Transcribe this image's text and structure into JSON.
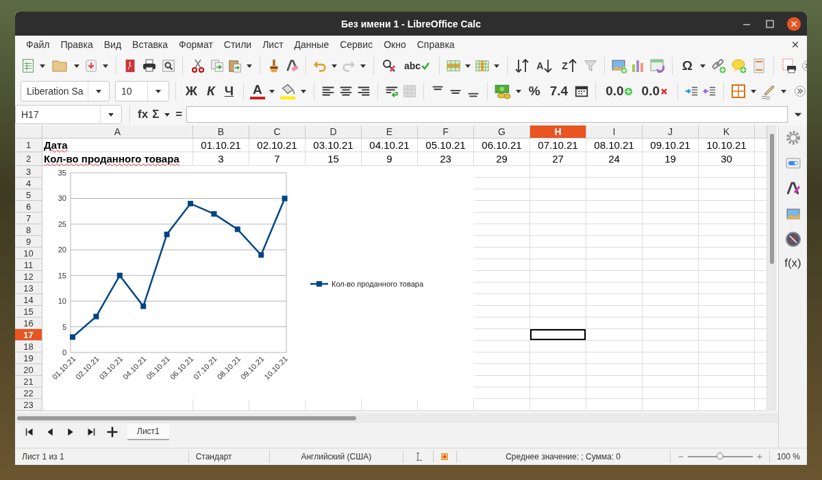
{
  "window": {
    "title": "Без имени 1 - LibreOffice Calc"
  },
  "menu": [
    "Файл",
    "Правка",
    "Вид",
    "Вставка",
    "Формат",
    "Стили",
    "Лист",
    "Данные",
    "Сервис",
    "Окно",
    "Справка"
  ],
  "standard_toolbar": {
    "spelling": "abc",
    "sort_ascending": "A",
    "sort_descending": "Z",
    "special_character": "Ω"
  },
  "formatting_toolbar": {
    "font_name": "Liberation Sa",
    "font_size": "10",
    "bold": "Ж",
    "italic": "К",
    "underline": "Ч",
    "font_color": "A",
    "percent": "%",
    "number": "7.4",
    "add_decimal_place": "0.0",
    "delete_decimal_place": "0.0"
  },
  "formula_bar": {
    "name_box": "H17",
    "function_wizard": "fx",
    "sum": "Σ",
    "formula": "="
  },
  "sheet": {
    "columns": [
      {
        "label": "A",
        "selected": false
      },
      {
        "label": "B",
        "selected": false
      },
      {
        "label": "C",
        "selected": false
      },
      {
        "label": "D",
        "selected": false
      },
      {
        "label": "E",
        "selected": false
      },
      {
        "label": "F",
        "selected": false
      },
      {
        "label": "G",
        "selected": false
      },
      {
        "label": "H",
        "selected": true
      },
      {
        "label": "I",
        "selected": false
      },
      {
        "label": "J",
        "selected": false
      },
      {
        "label": "K",
        "selected": false
      }
    ],
    "rows": [
      {
        "label": "1",
        "selected": false,
        "title": {
          "text": "Дата",
          "spell_error": true
        },
        "values": [
          "01.10.21",
          "02.10.21",
          "03.10.21",
          "04.10.21",
          "05.10.21",
          "06.10.21",
          "07.10.21",
          "08.10.21",
          "09.10.21",
          "10.10.21"
        ]
      },
      {
        "label": "2",
        "selected": false,
        "title": {
          "text": "Кол-во проданного товара",
          "spell_error": true
        },
        "values": [
          "3",
          "7",
          "15",
          "9",
          "23",
          "29",
          "27",
          "24",
          "19",
          "30"
        ]
      },
      {
        "label": "3",
        "selected": false
      },
      {
        "label": "4",
        "selected": false
      },
      {
        "label": "5",
        "selected": false
      },
      {
        "label": "6",
        "selected": false
      },
      {
        "label": "7",
        "selected": false
      },
      {
        "label": "8",
        "selected": false
      },
      {
        "label": "9",
        "selected": false
      },
      {
        "label": "10",
        "selected": false
      },
      {
        "label": "11",
        "selected": false
      },
      {
        "label": "12",
        "selected": false
      },
      {
        "label": "13",
        "selected": false
      },
      {
        "label": "14",
        "selected": false
      },
      {
        "label": "15",
        "selected": false
      },
      {
        "label": "16",
        "selected": false
      },
      {
        "label": "17",
        "selected": true
      },
      {
        "label": "18",
        "selected": false
      },
      {
        "label": "19",
        "selected": false
      },
      {
        "label": "20",
        "selected": false
      },
      {
        "label": "21",
        "selected": false
      },
      {
        "label": "22",
        "selected": false
      },
      {
        "label": "23",
        "selected": false
      }
    ]
  },
  "chart": {
    "chart_data": {
      "type": "line",
      "categories": [
        "01.10.21",
        "02.10.21",
        "03.10.21",
        "04.10.21",
        "05.10.21",
        "06.10.21",
        "07.10.21",
        "08.10.21",
        "09.10.21",
        "10.10.21"
      ],
      "series": [
        {
          "name": "Кол-во проданного товара",
          "color": "#004586",
          "marker": "square",
          "values": [
            3,
            7,
            15,
            9,
            23,
            29,
            27,
            24,
            19,
            30
          ]
        }
      ],
      "grid": true,
      "ylim": [
        0,
        35
      ],
      "yticks": [
        0,
        5,
        10,
        15,
        20,
        25,
        30,
        35
      ]
    }
  },
  "sidebar": {
    "functions": "f(x)"
  },
  "sheet_tabs": [
    {
      "label": "Лист1",
      "selected": true
    }
  ],
  "status_bar": {
    "sheet": "Лист 1 из 1",
    "page_style": "Стандарт",
    "language": "Английский (США)",
    "summary": "Среднее значение: ; Сумма: 0",
    "zoom_slider": {
      "level": 0.5
    },
    "zoom": "100 %"
  }
}
